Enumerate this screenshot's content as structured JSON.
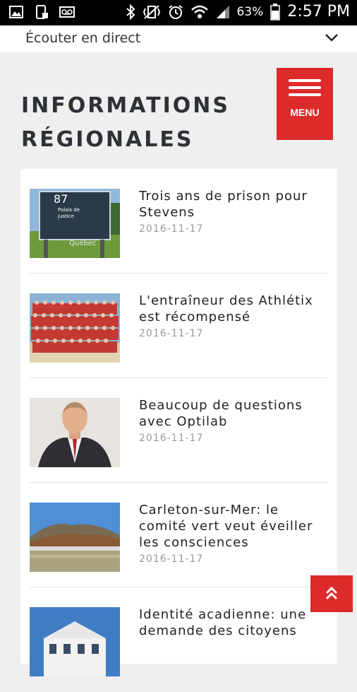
{
  "status_bar": {
    "battery_percent": "63%",
    "time": "2:57 PM",
    "left_icons": [
      "image-icon",
      "phone-card-icon",
      "voicemail-icon"
    ],
    "right_icons": [
      "bluetooth-icon",
      "vibrate-icon",
      "alarm-icon",
      "wifi-icon",
      "signal-icon",
      "battery-icon"
    ]
  },
  "listen_bar": {
    "label": "Écouter en direct"
  },
  "header": {
    "title_line1": "INFORMATIONS",
    "title_line2": "RÉGIONALES",
    "menu_label": "MENU"
  },
  "articles": [
    {
      "title": "Trois ans de prison pour Stevens",
      "date": "2016-11-17"
    },
    {
      "title": "L'entraîneur des Athlétix est récompensé",
      "date": "2016-11-17"
    },
    {
      "title": "Beaucoup de questions avec Optilab",
      "date": "2016-11-17"
    },
    {
      "title": "Carleton-sur-Mer: le comité vert veut éveiller les consciences",
      "date": "2016-11-17"
    },
    {
      "title": "Identité acadienne: une demande des citoyens",
      "date": ""
    }
  ],
  "thumb_sign_text": {
    "number": "87",
    "line1": "Palais de",
    "line2": "justice",
    "brand": "Québec"
  },
  "colors": {
    "accent": "#dd2b2b",
    "background": "#efefef",
    "title": "#2f3138",
    "date": "#999999"
  }
}
